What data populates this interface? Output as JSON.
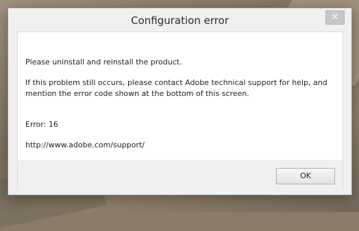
{
  "dialog": {
    "title": "Configuration error",
    "close_glyph": "✕",
    "message_line1": "Please uninstall and reinstall the product.",
    "message_line2": "If this problem still occurs, please contact Adobe technical support for help, and mention the error code shown at the bottom of this screen.",
    "error_code": "Error: 16",
    "support_url": "http://www.adobe.com/support/",
    "ok_label": "OK"
  },
  "colors": {
    "dialog_background": "#f0f0f0",
    "content_background": "#ffffff",
    "close_button": "#c7c7c7"
  }
}
